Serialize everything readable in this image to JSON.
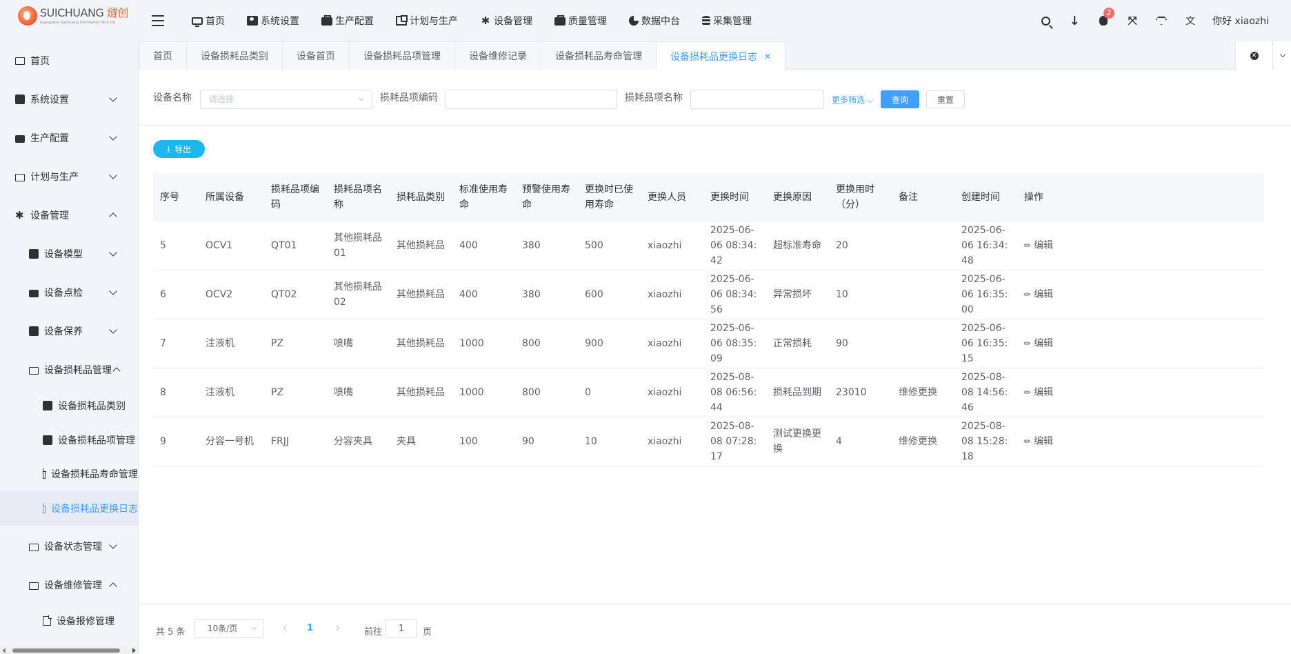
{
  "logo": {
    "name_en": "SUICHUANG",
    "name_cn": "燧创",
    "subtitle": "Guangzhou Suichuang Information Tech Ltd"
  },
  "topnav": [
    {
      "label": "首页",
      "icon": "monitor-icon"
    },
    {
      "label": "系统设置",
      "icon": "user-card-icon"
    },
    {
      "label": "生产配置",
      "icon": "briefcase-icon"
    },
    {
      "label": "计划与生产",
      "icon": "plan-icon"
    },
    {
      "label": "设备管理",
      "icon": "gear-icon"
    },
    {
      "label": "质量管理",
      "icon": "briefcase-icon"
    },
    {
      "label": "数据中台",
      "icon": "pie-chart-icon"
    },
    {
      "label": "采集管理",
      "icon": "database-icon"
    }
  ],
  "header": {
    "notification_count": "2",
    "greeting": "你好 xiaozhi"
  },
  "sidebar": {
    "items": [
      {
        "label": "首页"
      },
      {
        "label": "系统设置"
      },
      {
        "label": "生产配置"
      },
      {
        "label": "计划与生产"
      },
      {
        "label": "设备管理"
      },
      {
        "label": "设备模型"
      },
      {
        "label": "设备点检"
      },
      {
        "label": "设备保养"
      },
      {
        "label": "设备损耗品管理"
      },
      {
        "label": "设备损耗品类别"
      },
      {
        "label": "设备损耗品项管理"
      },
      {
        "label": "设备损耗品寿命管理"
      },
      {
        "label": "设备损耗品更换日志"
      },
      {
        "label": "设备状态管理"
      },
      {
        "label": "设备维修管理"
      },
      {
        "label": "设备报修管理"
      }
    ]
  },
  "tabs": [
    {
      "label": "首页"
    },
    {
      "label": "设备损耗品类别"
    },
    {
      "label": "设备首页"
    },
    {
      "label": "设备损耗品项管理"
    },
    {
      "label": "设备维修记录"
    },
    {
      "label": "设备损耗品寿命管理"
    },
    {
      "label": "设备损耗品更换日志"
    }
  ],
  "filter": {
    "device_label": "设备名称",
    "device_placeholder": "请选择",
    "code_label": "损耗品项编码",
    "code_value": "",
    "name_label": "损耗品项名称",
    "name_value": "",
    "more": "更多筛选",
    "query": "查询",
    "reset": "重置"
  },
  "export_label": "导出",
  "table": {
    "columns": [
      "序号",
      "所属设备",
      "损耗品项编码",
      "损耗品项名称",
      "损耗品类别",
      "标准使用寿命",
      "预警使用寿命",
      "更换时已使用寿命",
      "更换人员",
      "更换时间",
      "更换原因",
      "更换用时（分）",
      "备注",
      "创建时间",
      "操作"
    ],
    "edit_label": "编辑",
    "rows": [
      [
        "5",
        "OCV1",
        "QT01",
        "其他损耗品01",
        "其他损耗品",
        "400",
        "380",
        "500",
        "xiaozhi",
        "2025-06-06 08:34:42",
        "超标准寿命",
        "20",
        "",
        "2025-06-06 16:34:48"
      ],
      [
        "6",
        "OCV2",
        "QT02",
        "其他损耗品02",
        "其他损耗品",
        "400",
        "380",
        "600",
        "xiaozhi",
        "2025-06-06 08:34:56",
        "异常损坏",
        "10",
        "",
        "2025-06-06 16:35:00"
      ],
      [
        "7",
        "注液机",
        "PZ",
        "喷嘴",
        "其他损耗品",
        "1000",
        "800",
        "900",
        "xiaozhi",
        "2025-06-06 08:35:09",
        "正常损耗",
        "90",
        "",
        "2025-06-06 16:35:15"
      ],
      [
        "8",
        "注液机",
        "PZ",
        "喷嘴",
        "其他损耗品",
        "1000",
        "800",
        "0",
        "xiaozhi",
        "2025-08-08 06:56:44",
        "损耗品到期",
        "23010",
        "维修更换",
        "2025-08-08 14:56:46"
      ],
      [
        "9",
        "分容一号机",
        "FRJJ",
        "分容夹具",
        "夹具",
        "100",
        "90",
        "10",
        "xiaozhi",
        "2025-08-08 07:28:17",
        "测试更换更换",
        "4",
        "维修更换",
        "2025-08-08 15:28:18"
      ]
    ]
  },
  "pager": {
    "total": "共 5 条",
    "page_size": "10条/页",
    "current": "1",
    "goto_label": "前往",
    "goto_value": "1",
    "page_suffix": "页"
  }
}
